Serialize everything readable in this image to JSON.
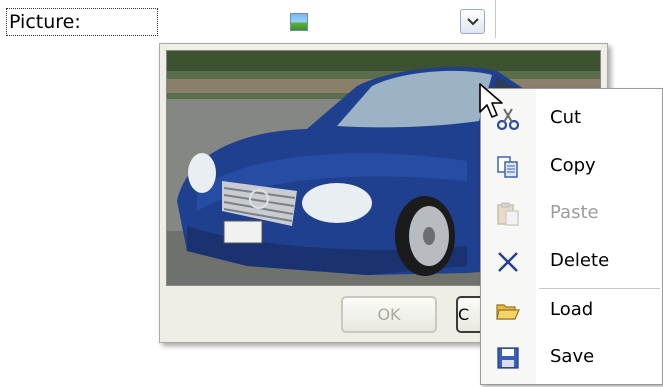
{
  "field": {
    "label": "Picture:",
    "thumbnail_icon": "picture-icon",
    "dropdown_icon": "chevron-down-icon"
  },
  "popup": {
    "image_alt": "blue coupe car photo",
    "ok_label": "OK",
    "cancel_label": "C"
  },
  "context_menu": {
    "items": [
      {
        "label": "Cut",
        "icon": "scissors-icon",
        "enabled": true
      },
      {
        "label": "Copy",
        "icon": "copy-icon",
        "enabled": true
      },
      {
        "label": "Paste",
        "icon": "paste-icon",
        "enabled": false
      },
      {
        "label": "Delete",
        "icon": "delete-x-icon",
        "enabled": true
      },
      {
        "label": "Load",
        "icon": "folder-icon",
        "enabled": true
      },
      {
        "label": "Save",
        "icon": "floppy-icon",
        "enabled": true
      }
    ]
  },
  "colors": {
    "car": "#1f3f8f",
    "menu_border": "#9a9a9a",
    "popup_bg": "#efeee6"
  }
}
